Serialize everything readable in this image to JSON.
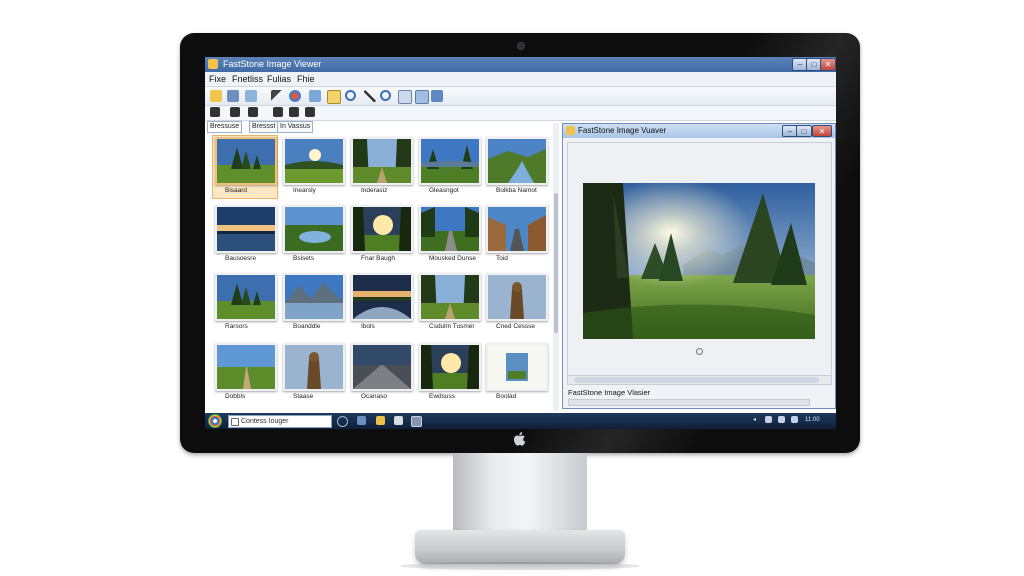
{
  "main_window": {
    "title": "FastStone Image Viewer",
    "controls": {
      "minimize": "–",
      "maximize": "□",
      "close": "✕"
    }
  },
  "menu": [
    {
      "label": "Fixe"
    },
    {
      "label": "Fnetliss"
    },
    {
      "label": "Fulias"
    },
    {
      "label": "Fhie"
    }
  ],
  "tabs": [
    {
      "label": "Bressuse"
    },
    {
      "label": "Bressst"
    },
    {
      "label": "In Vassus"
    }
  ],
  "thumbnails": [
    {
      "label": "Bisaard",
      "scene": "trees-meadow",
      "selected": true
    },
    {
      "label": "Inearsly",
      "scene": "meadow-sun",
      "selected": false
    },
    {
      "label": "Inderasiz",
      "scene": "forest-path",
      "selected": false
    },
    {
      "label": "Gleasngot",
      "scene": "trees-sky",
      "selected": false
    },
    {
      "label": "Bolkba Namot",
      "scene": "river-valley",
      "selected": false
    },
    {
      "label": "Bausoesre",
      "scene": "lake-sunset",
      "selected": false
    },
    {
      "label": "Bsisets",
      "scene": "lake-meadow",
      "selected": false
    },
    {
      "label": "Fnar Baugh",
      "scene": "sunburst-forest",
      "selected": false
    },
    {
      "label": "Mousked Dunse",
      "scene": "road-forest",
      "selected": false
    },
    {
      "label": "Toid",
      "scene": "canyon-road",
      "selected": false
    },
    {
      "label": "Rarsors",
      "scene": "trees-meadow",
      "selected": false
    },
    {
      "label": "Boanddle",
      "scene": "mountain-lake",
      "selected": false
    },
    {
      "label": "Ibols",
      "scene": "river-sunset",
      "selected": false
    },
    {
      "label": "Csdulm Tusmer",
      "scene": "forest-path",
      "selected": false
    },
    {
      "label": "Cned Cessse",
      "scene": "statue",
      "selected": false
    },
    {
      "label": "Dobbls",
      "scene": "field-road",
      "selected": false
    },
    {
      "label": "Staase",
      "scene": "statue",
      "selected": false
    },
    {
      "label": "Ocanaso",
      "scene": "road-dusk",
      "selected": false
    },
    {
      "label": "Ewdsuss",
      "scene": "sunburst-forest",
      "selected": false
    },
    {
      "label": "Boolad",
      "scene": "document",
      "selected": false
    }
  ],
  "viewer_window": {
    "title": "FastStone Image Vuaver",
    "status_label": "FastStone Image Vlasier",
    "controls": {
      "minimize": "–",
      "maximize": "□",
      "close": "✕"
    }
  },
  "taskbar": {
    "search_text": "Contess Iouger",
    "clock": "11:00"
  },
  "icons": {
    "system": "apple-logo",
    "start": "chrome-start-orb"
  },
  "colors": {
    "bezel": "#0d0d0e",
    "titlebar": "#3f6aa5",
    "taskbar": "#0e2038",
    "selection": "#fbe8c6"
  }
}
